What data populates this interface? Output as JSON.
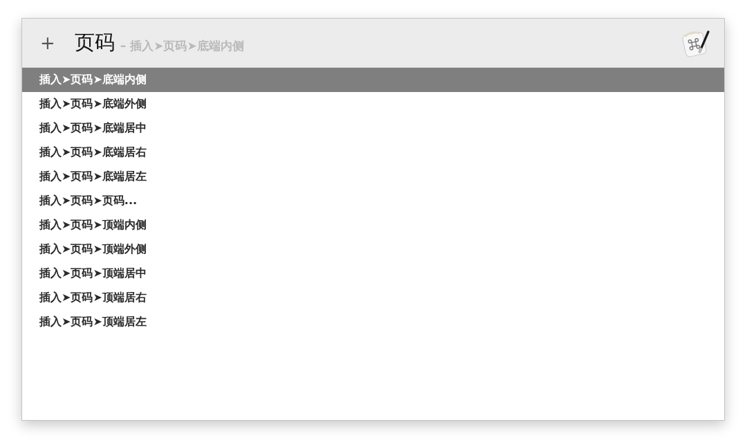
{
  "header": {
    "add_button": "+",
    "title": "页码",
    "subtitle": "– 插入➤页码➤底端内侧"
  },
  "results": [
    {
      "label": "插入➤页码➤底端内侧",
      "selected": true
    },
    {
      "label": "插入➤页码➤底端外侧",
      "selected": false
    },
    {
      "label": "插入➤页码➤底端居中",
      "selected": false
    },
    {
      "label": "插入➤页码➤底端居右",
      "selected": false
    },
    {
      "label": "插入➤页码➤底端居左",
      "selected": false
    },
    {
      "label": "插入➤页码➤页码...",
      "selected": false
    },
    {
      "label": "插入➤页码➤顶端内侧",
      "selected": false
    },
    {
      "label": "插入➤页码➤顶端外侧",
      "selected": false
    },
    {
      "label": "插入➤页码➤顶端居中",
      "selected": false
    },
    {
      "label": "插入➤页码➤顶端居右",
      "selected": false
    },
    {
      "label": "插入➤页码➤顶端居左",
      "selected": false
    }
  ]
}
